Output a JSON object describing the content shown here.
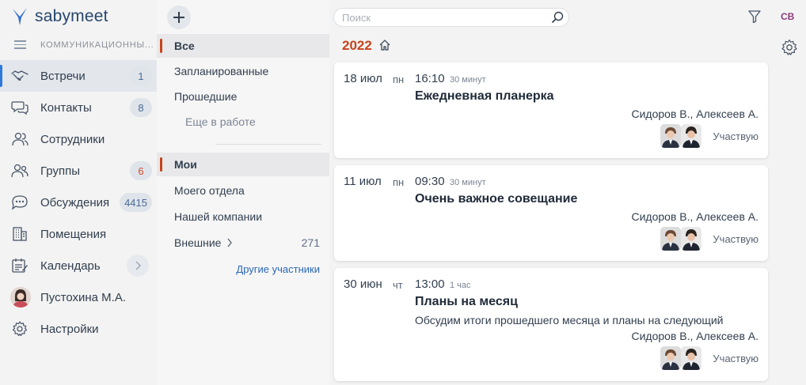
{
  "app": {
    "brand": "sabymeet",
    "section_label": "КОММУНИКАЦИОННЫ..."
  },
  "nav": {
    "items": [
      {
        "label": "Встречи",
        "count": "1",
        "icon": "handshake-icon"
      },
      {
        "label": "Контакты",
        "count": "8",
        "icon": "chat-bubbles-icon"
      },
      {
        "label": "Сотрудники",
        "icon": "users-icon"
      },
      {
        "label": "Группы",
        "count": "6",
        "icon": "group-icon"
      },
      {
        "label": "Обсуждения",
        "count": "4415",
        "icon": "discussion-icon"
      },
      {
        "label": "Помещения",
        "icon": "building-icon"
      },
      {
        "label": "Календарь",
        "icon": "calendar-icon"
      },
      {
        "label": "Пустохина М.А.",
        "icon": "avatar"
      },
      {
        "label": "Настройки",
        "icon": "gear-icon"
      }
    ]
  },
  "filters": {
    "all": "Все",
    "planned": "Запланированные",
    "past": "Прошедшие",
    "in_progress": "Еще в работе",
    "mine": "Мои",
    "my_dept": "Моего отдела",
    "our_company": "Нашей компании",
    "external": "Внешние",
    "external_count": "271",
    "other_participants": "Другие участники"
  },
  "search": {
    "placeholder": "Поиск"
  },
  "header": {
    "year": "2022",
    "user_initials": "СВ"
  },
  "meetings": [
    {
      "date": "18 июл",
      "dow": "пн",
      "time": "16:10",
      "duration": "30 минут",
      "title": "Ежедневная планерка",
      "description": "",
      "people": "Сидоров В., Алексеев А.",
      "status": "Участвую"
    },
    {
      "date": "11 июл",
      "dow": "пн",
      "time": "09:30",
      "duration": "30 минут",
      "title": "Очень важное совещание",
      "description": "",
      "people": "Сидоров В., Алексеев А.",
      "status": "Участвую"
    },
    {
      "date": "30 июн",
      "dow": "чт",
      "time": "13:00",
      "duration": "1 час",
      "title": "Планы на месяц",
      "description": "Обсудим итоги прошедшего месяца и планы на следующий",
      "people": "Сидоров В., Алексеев А.",
      "status": "Участвую"
    }
  ],
  "colors": {
    "accent": "#c8431d",
    "active_bar": "#2f7ad8",
    "brand": "#27466c"
  }
}
